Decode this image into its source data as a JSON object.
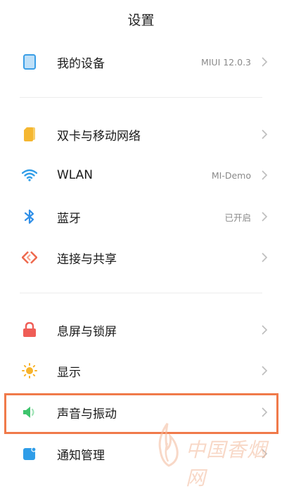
{
  "header": {
    "title": "设置"
  },
  "items": [
    {
      "id": "device",
      "label": "我的设备",
      "value": "MIUI 12.0.3",
      "icon": "phone-icon"
    },
    {
      "id": "dualsim",
      "label": "双卡与移动网络",
      "value": "",
      "icon": "sim-card-icon"
    },
    {
      "id": "wlan",
      "label": "WLAN",
      "value": "MI-Demo",
      "icon": "wifi-icon"
    },
    {
      "id": "bt",
      "label": "蓝牙",
      "value": "已开启",
      "icon": "bluetooth-icon"
    },
    {
      "id": "share",
      "label": "连接与共享",
      "value": "",
      "icon": "connection-share-icon"
    },
    {
      "id": "lock",
      "label": "息屏与锁屏",
      "value": "",
      "icon": "lock-icon"
    },
    {
      "id": "display",
      "label": "显示",
      "value": "",
      "icon": "sun-icon"
    },
    {
      "id": "sound",
      "label": "声音与振动",
      "value": "",
      "icon": "speaker-icon"
    },
    {
      "id": "notify",
      "label": "通知管理",
      "value": "",
      "icon": "notification-icon"
    }
  ],
  "watermark": {
    "text": "中国香烟网"
  },
  "colors": {
    "highlight": "#f07a4a",
    "device": "#3a9ee6",
    "sim": "#f5b731",
    "wifi": "#2f9de8",
    "bluetooth": "#2f8fe8",
    "share": "#ee6a4f",
    "lock": "#ef5d56",
    "display": "#f7b32b",
    "sound": "#3ec46d",
    "notify": "#2f9de8"
  }
}
